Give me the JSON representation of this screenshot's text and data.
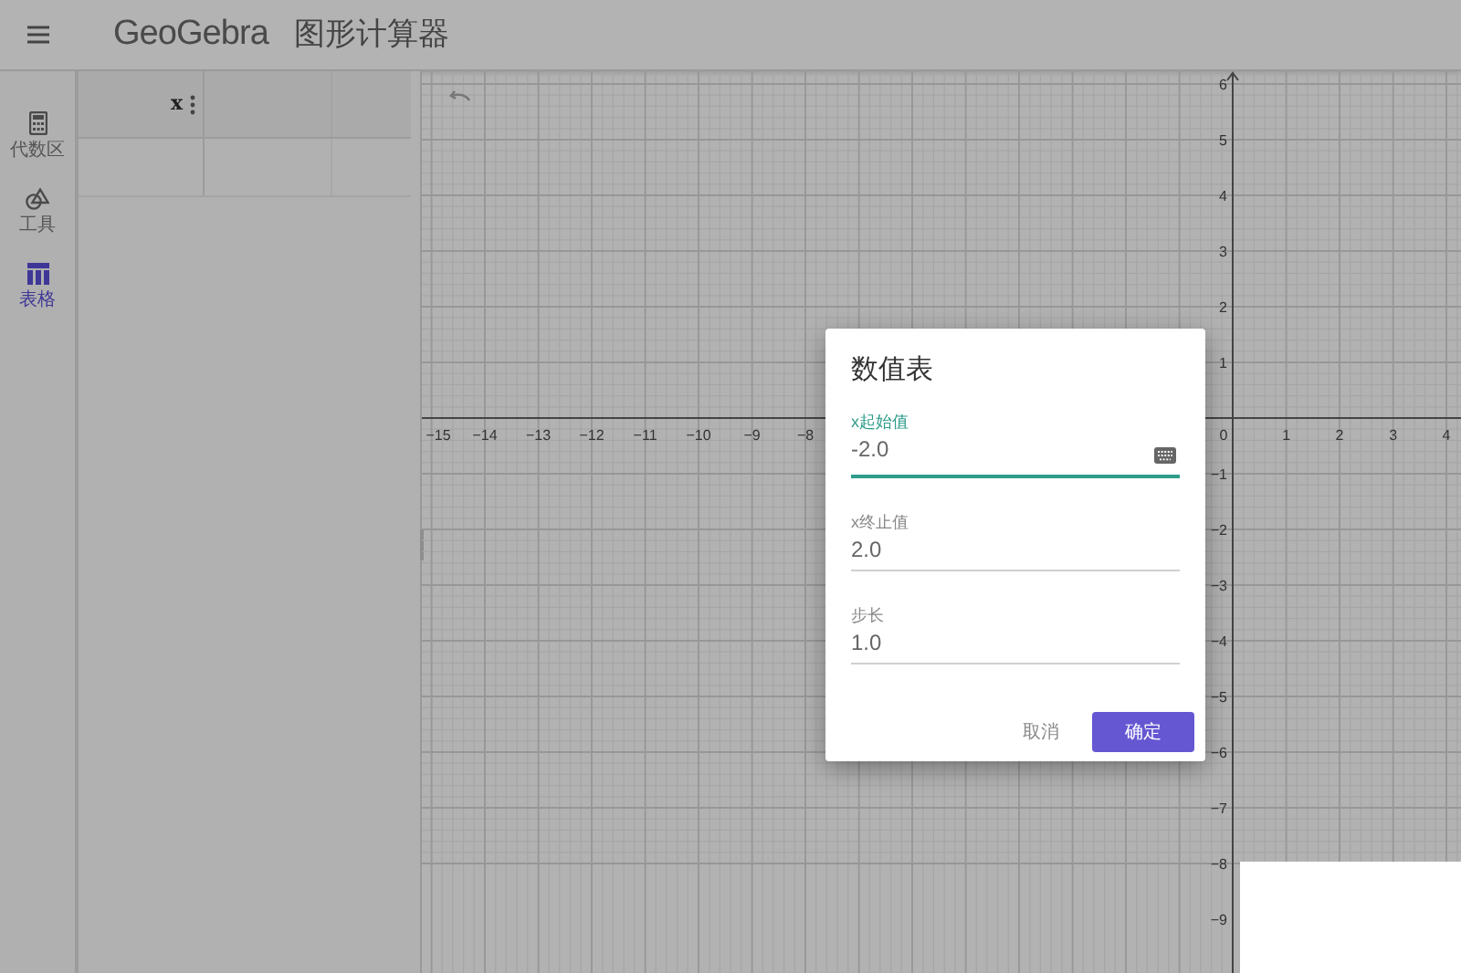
{
  "app_bar": {
    "logo": "GeoGebra",
    "title": "图形计算器"
  },
  "sidebar": {
    "items": [
      {
        "label": "代数区",
        "kind": "calculator",
        "selected": false
      },
      {
        "label": "工具",
        "kind": "tools",
        "selected": false
      },
      {
        "label": "表格",
        "kind": "table",
        "selected": true
      }
    ]
  },
  "table_view": {
    "columns": [
      {
        "header": "x"
      }
    ]
  },
  "graph": {
    "x_labels": [
      "−15",
      "−14",
      "−13",
      "−12",
      "−11",
      "−10",
      "−9",
      "−8",
      "0",
      "1",
      "2",
      "3",
      "4"
    ],
    "y_labels": [
      "6",
      "5",
      "4",
      "3",
      "2",
      "1",
      "−1",
      "−2",
      "−3",
      "−4",
      "−5",
      "−6",
      "−7",
      "−8",
      "−9"
    ]
  },
  "dialog": {
    "title": "数值表",
    "fields": [
      {
        "label": "x起始值",
        "value": "-2.0",
        "focused": true
      },
      {
        "label": "x终止值",
        "value": "2.0",
        "focused": false
      },
      {
        "label": "步长",
        "value": "1.0",
        "focused": false
      }
    ],
    "buttons": [
      {
        "label": "取消",
        "kind": "text"
      },
      {
        "label": "确定",
        "kind": "primary"
      }
    ]
  }
}
